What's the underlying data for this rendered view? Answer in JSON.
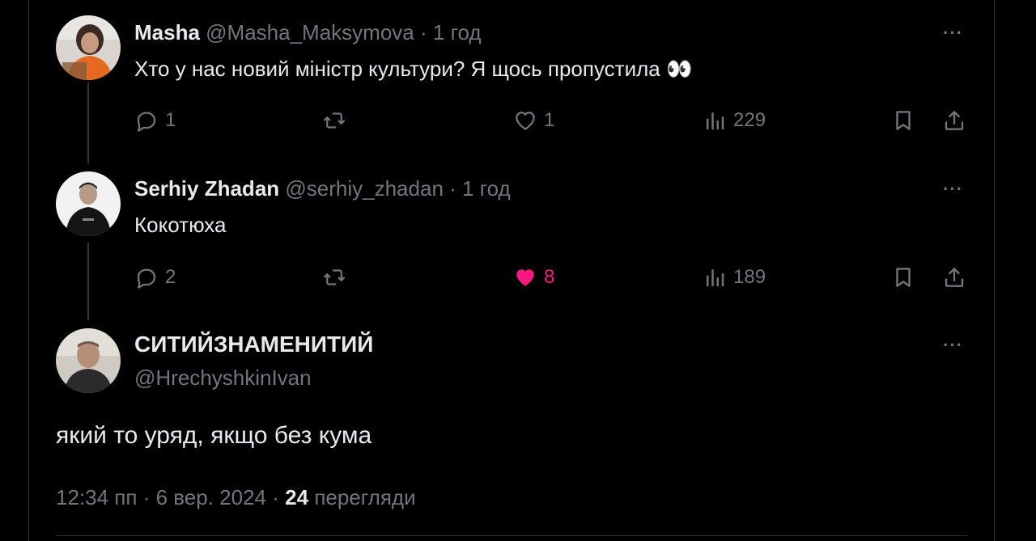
{
  "reply1": {
    "name": "Masha",
    "handle": "@Masha_Maksymova",
    "dot": "·",
    "time": "1 год",
    "text": "Хто у нас новий міністр культури? Я щось пропустила 👀",
    "more": "···",
    "replies": "1",
    "reposts": "",
    "likes": "1",
    "views": "229",
    "liked": false
  },
  "reply2": {
    "name": "Serhiy Zhadan",
    "handle": "@serhiy_zhadan",
    "dot": "·",
    "time": "1 год",
    "text": "Кокотюха",
    "more": "···",
    "replies": "2",
    "reposts": "",
    "likes": "8",
    "views": "189",
    "liked": true
  },
  "main": {
    "name": "СИТИЙЗНАМЕНИТИЙ",
    "handle": "@HrechyshkinIvan",
    "text": "який то уряд, якщо без кума",
    "more": "···",
    "time": "12:34 пп",
    "sep": "·",
    "date": "6 вер. 2024",
    "views_count": "24",
    "views_label": "перегляди"
  },
  "colors": {
    "background": "#000000",
    "text": "#e7e9ea",
    "muted": "#71767b",
    "like": "#f91880",
    "border": "#2f3336"
  }
}
